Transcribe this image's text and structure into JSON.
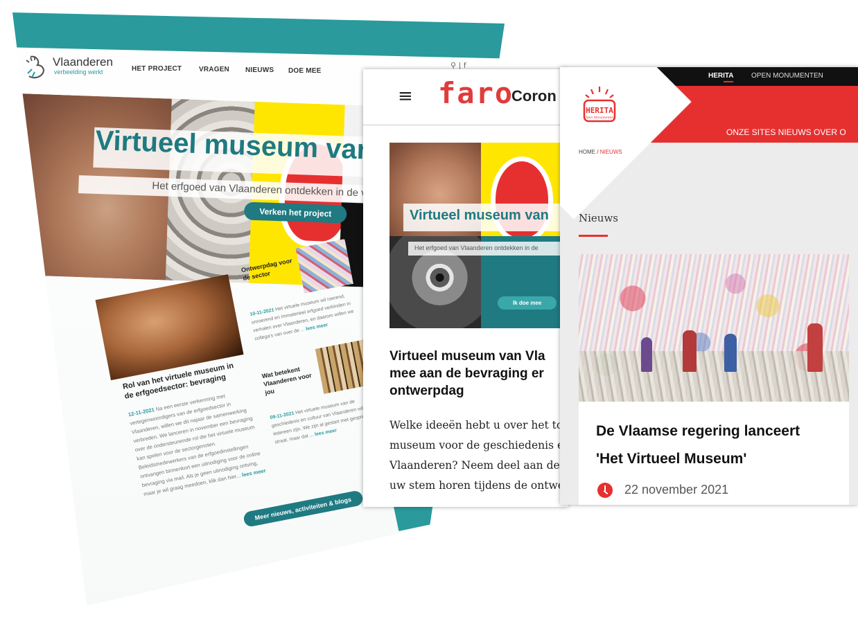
{
  "vlaanderen": {
    "brand": "Vlaanderen",
    "tagline": "verbeelding werkt",
    "nav": [
      "HET PROJECT",
      "VRAGEN",
      "NIEUWS",
      "DOE MEE"
    ],
    "hero": {
      "title": "Virtueel museum van V",
      "subtitle": "Het erfgoed van Vlaanderen ontdekken in de volg",
      "cta": "Verken het project"
    },
    "articles": [
      {
        "title": "Rol van het virtuele museum in de erfgoedsector: bevraging",
        "date": "12-11-2021",
        "text": "Na een eerste verkenning met vertegenwoordigers van de erfgoedsector in Vlaanderen, willen we dit najaar de samenwerking verbreden. We lanceren in november een bevraging over de ondersteunende rol die het virtuele museum kan spelen voor de sectorgenoten. Beleidsmedewerkers van de erfgoedinstellingen ontvangen binnenkort een uitnodiging voor de online bevraging via mail. Als je geen uitnodiging ontving, maar je wil graag meedoen, klik dan hier...",
        "more": "lees meer"
      },
      {
        "title": "Ontwerpdag voor de sector",
        "date": "10-11-2021",
        "text": "Het virtuele museum wil roerend, onroerend en immaterieel erfgoed verbinden in verhalen over Vlaanderen, en daarom willen we collega's van over de ...",
        "more": "lees meer"
      },
      {
        "title": "Wat betekent Vlaanderen voor jou",
        "date": "09-11-2021",
        "text": "Het virtuele museum van de geschiedenis en cultuur van Vlaanderen wil er voor iedereen zijn. We zijn al gestart met gesprekken op straat, maar dat ...",
        "more": "lees meer"
      }
    ],
    "more_button": "Meer nieuws, activiteiten & blogs"
  },
  "faro": {
    "logo": "faro",
    "header_title": "Coron",
    "hero": {
      "title": "Virtueel museum van",
      "subtitle": "Het erfgoed van Vlaanderen ontdekken in de",
      "button": "Ik doe mee"
    },
    "headline": "Virtueel museum van Vla\nmee aan de bevraging er\nontwerpdag",
    "body": "Welke ideeën hebt u over het to\nmuseum voor de geschiedenis e\nVlaanderen? Neem deel aan de\nuw stem horen tijdens de ontwe"
  },
  "herita": {
    "top_nav": [
      "HERITA",
      "OPEN MONUMENTEN"
    ],
    "main_nav": "ONZE SITES  NIEUWS  OVER O",
    "breadcrumb": {
      "home": "HOME",
      "sep": "/",
      "current": "NIEUWS"
    },
    "section_title": "Nieuws",
    "article": {
      "title": "De Vlaamse regering lanceert\n'Het Virtueel Museum'",
      "date": "22 november 2021"
    },
    "logo_text": "HERITA",
    "logo_sub": "Open Monumenten"
  },
  "colors": {
    "teal": "#2a9a9c",
    "teal_dark": "#1f7a82",
    "red": "#e63030",
    "faro_red": "#e13b3b",
    "yellow": "#ffe600"
  }
}
